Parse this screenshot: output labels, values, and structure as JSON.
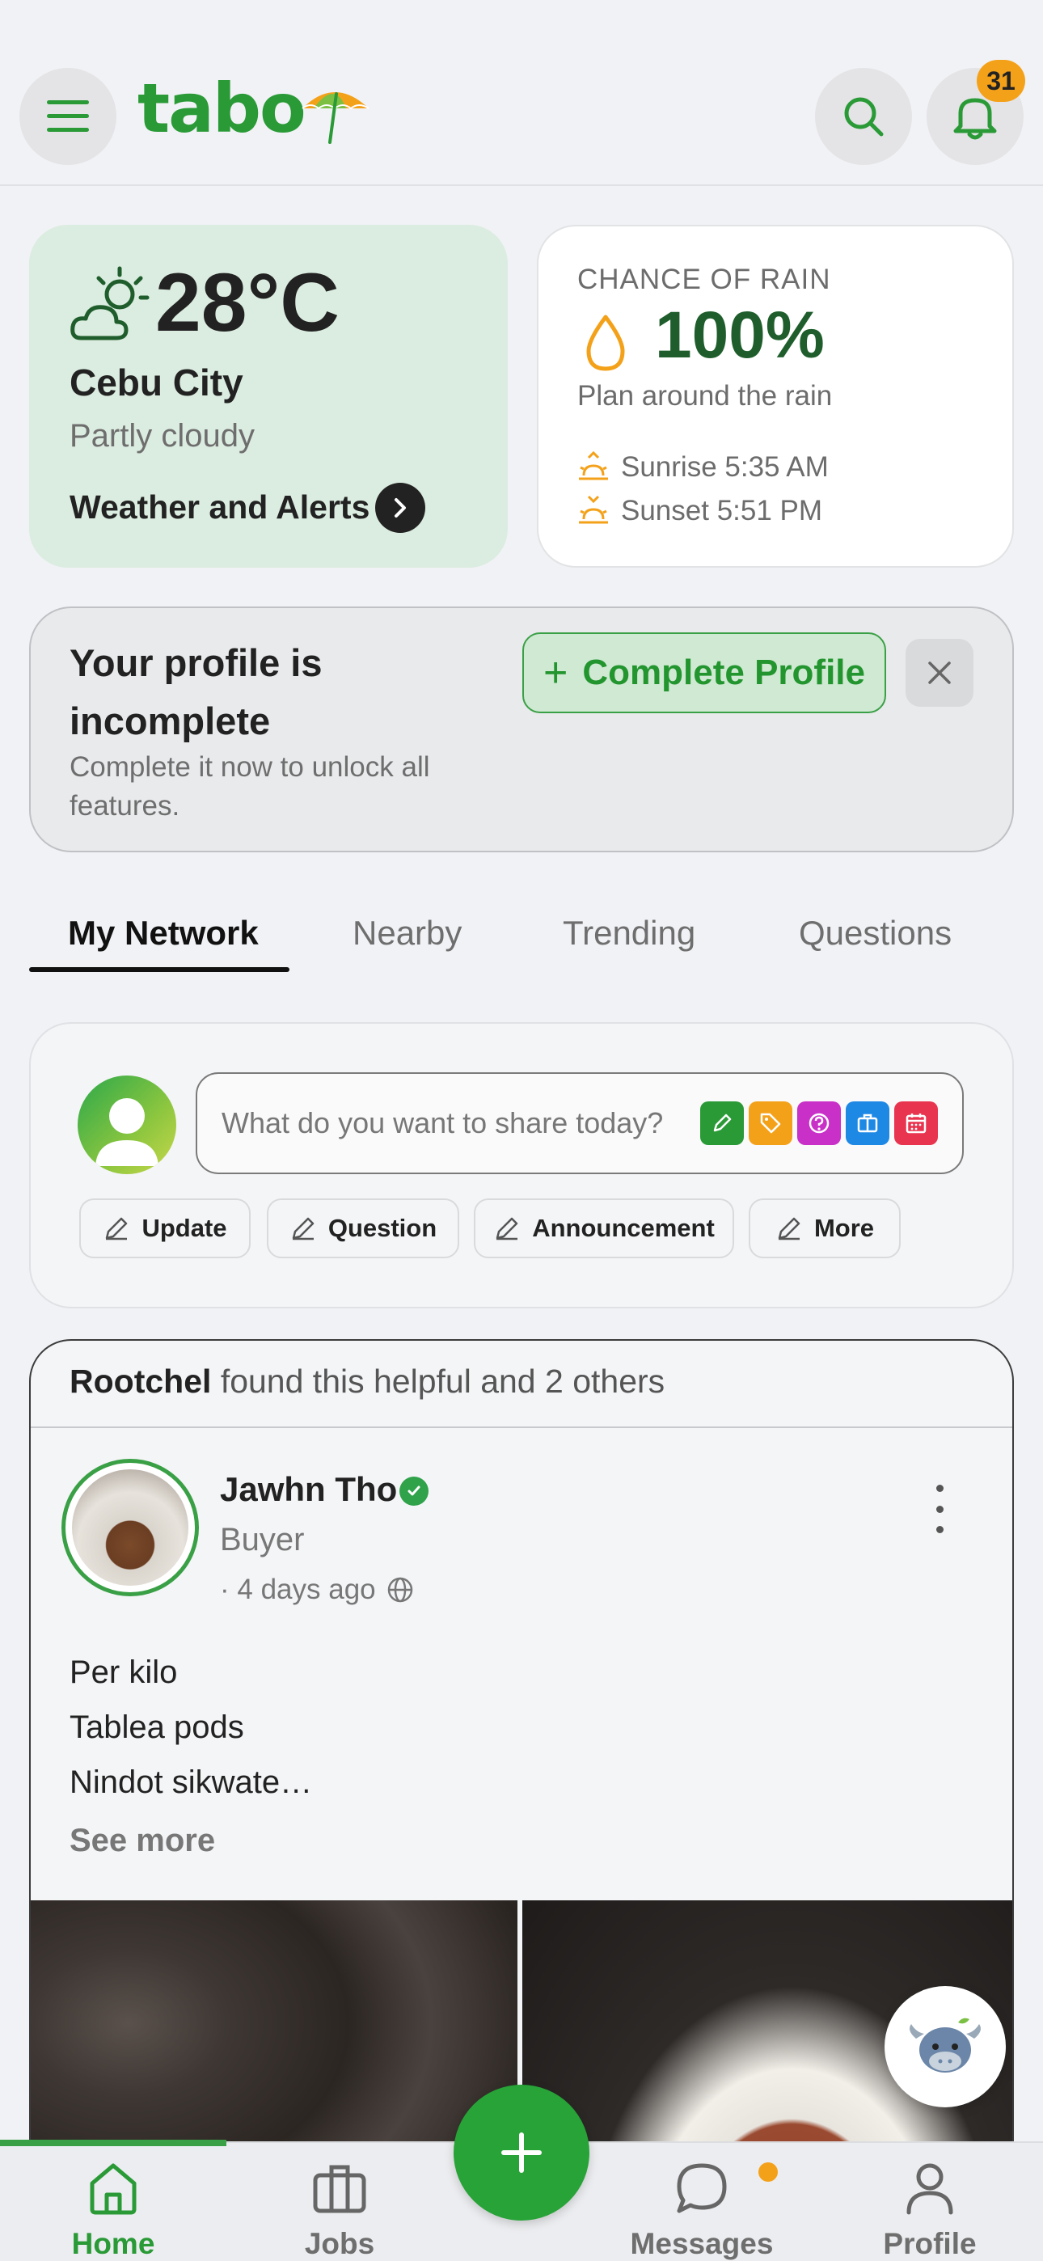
{
  "header": {
    "logo_text": "tabo",
    "notification_count": "31"
  },
  "weather": {
    "temperature": "28°C",
    "city": "Cebu City",
    "condition": "Partly cloudy",
    "alerts_link": "Weather and Alerts"
  },
  "rain": {
    "label": "CHANCE OF RAIN",
    "value": "100%",
    "advice": "Plan around the rain",
    "sunrise": "Sunrise 5:35 AM",
    "sunset": "Sunset 5:51 PM"
  },
  "profile_banner": {
    "title": "Your profile is incomplete",
    "subtitle": "Complete it now to unlock all features.",
    "button_label": "Complete Profile"
  },
  "tabs": [
    {
      "label": "My Network",
      "active": true
    },
    {
      "label": "Nearby",
      "active": false
    },
    {
      "label": "Trending",
      "active": false
    },
    {
      "label": "Questions",
      "active": false
    }
  ],
  "composer": {
    "placeholder": "What do you want to share today?",
    "chips": [
      "Update",
      "Question",
      "Announcement",
      "More"
    ]
  },
  "post": {
    "banner_name": "Rootchel",
    "banner_text": "found this helpful and 2 others",
    "author": "Jawhn Tho",
    "role": "Buyer",
    "time": "· 4 days ago",
    "lines": [
      "Per kilo",
      "Tablea pods",
      "Nindot sikwate…"
    ],
    "see_more": "See more"
  },
  "bottom_nav": [
    {
      "label": "Home",
      "icon": "home-icon",
      "active": true
    },
    {
      "label": "Jobs",
      "icon": "briefcase-icon",
      "active": false
    },
    {
      "label": "Messages",
      "icon": "chat-icon",
      "active": false
    },
    {
      "label": "Profile",
      "icon": "user-icon",
      "active": false
    }
  ],
  "colors": {
    "brand_green": "#2a9a37",
    "accent_orange": "#f4a11a",
    "weather_bg": "#dbece0"
  }
}
